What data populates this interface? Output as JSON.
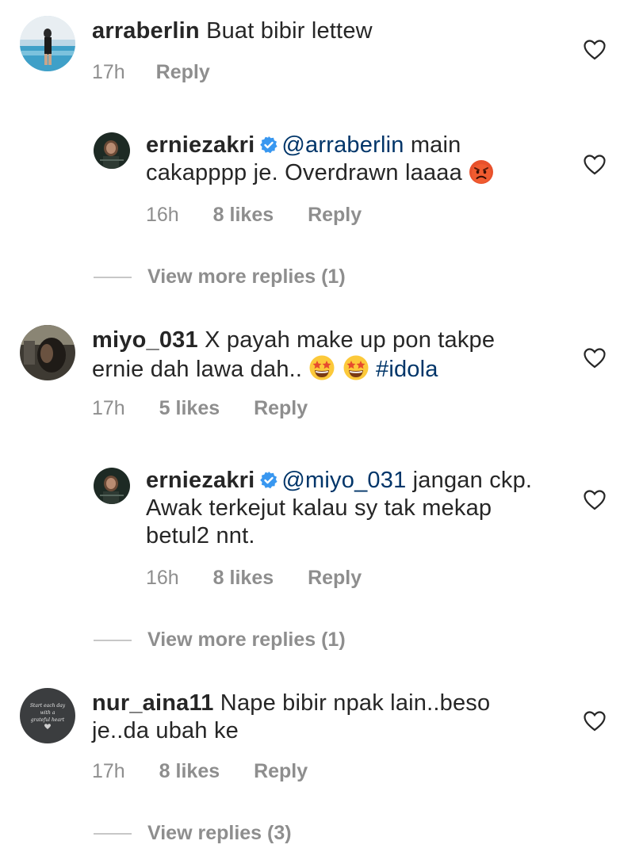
{
  "comments": [
    {
      "username": "arraberlin",
      "text": "Buat bibir lettew",
      "time": "17h",
      "reply_label": "Reply"
    },
    {
      "username": "erniezakri",
      "mention": "@arraberlin",
      "text": " main cakapppp je. Overdrawn laaaa ",
      "time": "16h",
      "likes": "8 likes",
      "reply_label": "Reply",
      "view_more": "View more replies (1)"
    },
    {
      "username": "miyo_031",
      "text": "X payah make up pon takpe ernie dah lawa dah.. ",
      "hashtag": "#idola",
      "time": "17h",
      "likes": "5 likes",
      "reply_label": "Reply"
    },
    {
      "username": "erniezakri",
      "mention": "@miyo_031",
      "text": " jangan ckp. Awak terkejut kalau sy tak mekap betul2 nnt.",
      "time": "16h",
      "likes": "8 likes",
      "reply_label": "Reply",
      "view_more": "View more replies (1)"
    },
    {
      "username": "nur_aina11",
      "text": "Nape bibir npak lain..beso je..da ubah ke",
      "time": "17h",
      "likes": "8 likes",
      "reply_label": "Reply",
      "view_more": "View replies (3)"
    }
  ],
  "icons": {
    "like": "heart-icon",
    "verified": "verified-badge-icon",
    "emoji_angry": "angry-face-emoji",
    "emoji_star": "star-struck-emoji"
  },
  "colors": {
    "link": "#003569",
    "meta": "#8e8e8e",
    "verified": "#3897f0"
  }
}
